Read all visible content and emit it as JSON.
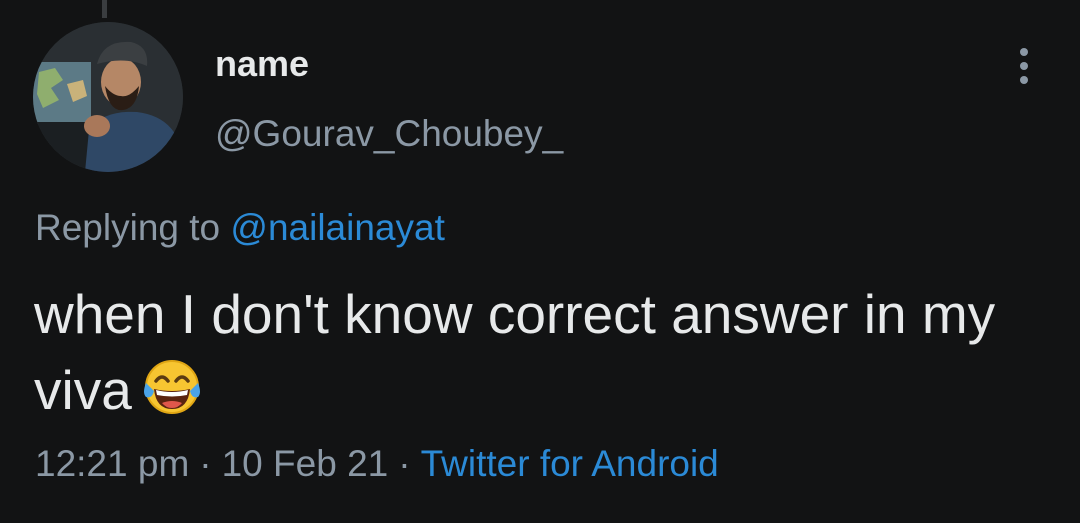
{
  "author": {
    "display_name": "name",
    "handle": "@Gourav_Choubey_",
    "avatar_icon": "profile-photo"
  },
  "reply": {
    "prefix": "Replying to",
    "mention": "@nailainayat"
  },
  "tweet": {
    "text": "when I don't know correct answer in my viva",
    "emoji_icon": "face-with-tears-of-joy"
  },
  "meta": {
    "time": "12:21 pm",
    "separator": "·",
    "date": "10 Feb 21",
    "source": "Twitter for Android"
  },
  "colors": {
    "background": "#121314",
    "primary_text": "#e7e9ea",
    "secondary_text": "#8b98a5",
    "link": "#2b8ad6"
  }
}
